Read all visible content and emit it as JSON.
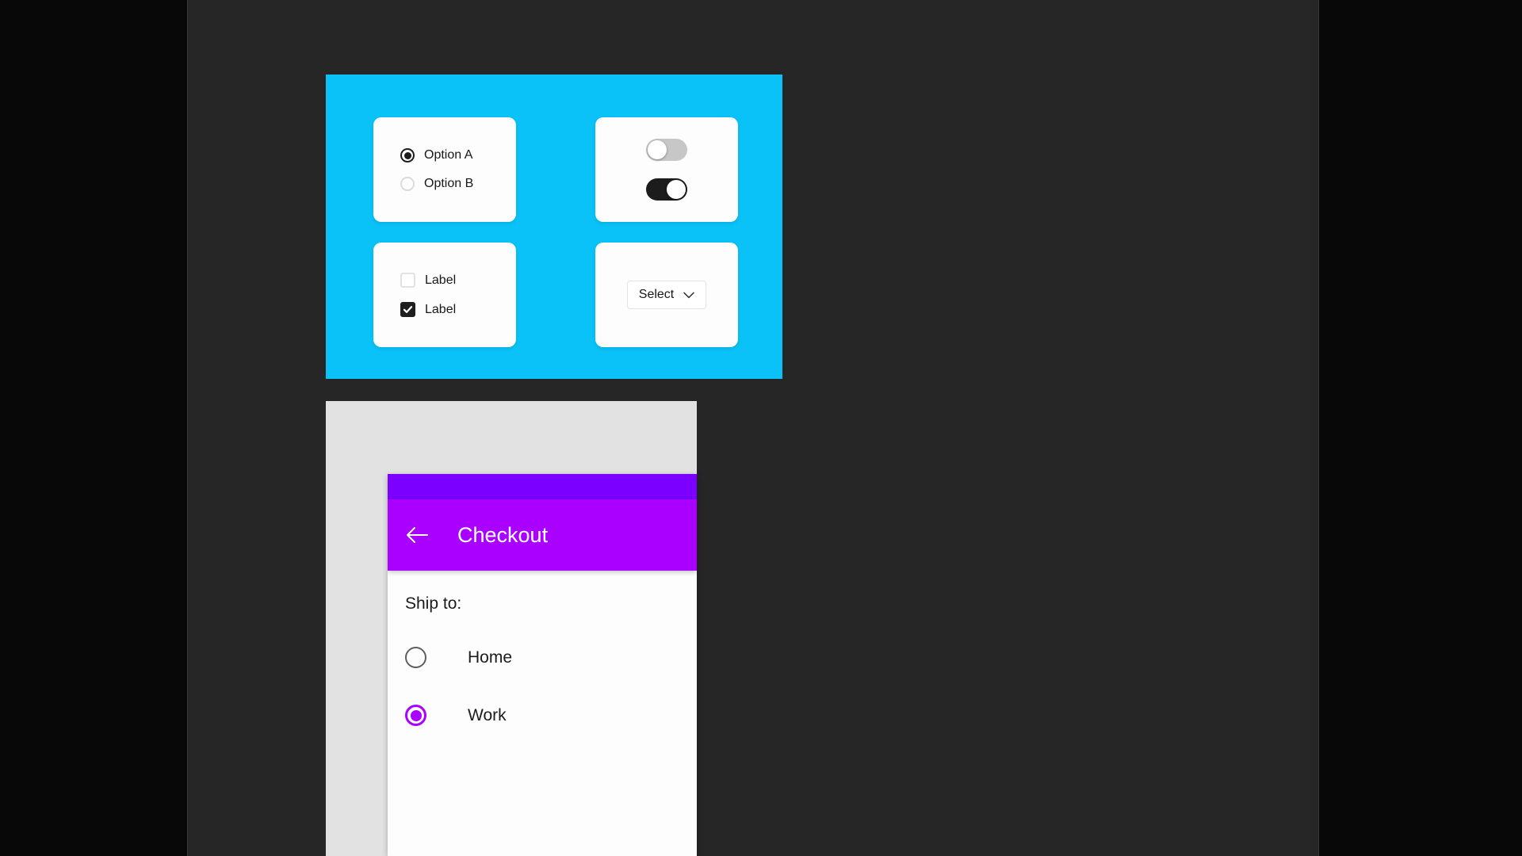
{
  "theme": {
    "outer_background": "#080808",
    "canvas_background": "#262626",
    "components_panel_background": "#0ac2f7",
    "device_frame_background": "#e2e2e2",
    "screen_background": "#fdfdfd",
    "status_bar_color": "#7b00ff",
    "app_bar_color": "#aa00ff",
    "accent_purple": "#aa00ff",
    "control_dark": "#1c1c1c",
    "control_muted": "#c7c7c7"
  },
  "components_panel": {
    "radio_card": {
      "name": "radio-group",
      "options": [
        {
          "label": "Option A",
          "selected": true
        },
        {
          "label": "Option B",
          "selected": false
        }
      ]
    },
    "toggle_card": {
      "name": "toggle-group",
      "toggles": [
        {
          "state": "off",
          "state_label": "off"
        },
        {
          "state": "on",
          "state_label": "on"
        }
      ]
    },
    "checkbox_card": {
      "name": "checkbox-group",
      "checkboxes": [
        {
          "label": "Label",
          "checked": false
        },
        {
          "label": "Label",
          "checked": true
        }
      ]
    },
    "select_card": {
      "name": "select-control",
      "button_label": "Select",
      "icon": "chevron-down-icon"
    }
  },
  "device_preview": {
    "status_bar": {
      "label": ""
    },
    "app_bar": {
      "back_icon": "arrow-left-icon",
      "title": "Checkout"
    },
    "content": {
      "section_label": "Ship to:",
      "options": [
        {
          "label": "Home",
          "selected": false
        },
        {
          "label": "Work",
          "selected": true
        }
      ]
    }
  }
}
